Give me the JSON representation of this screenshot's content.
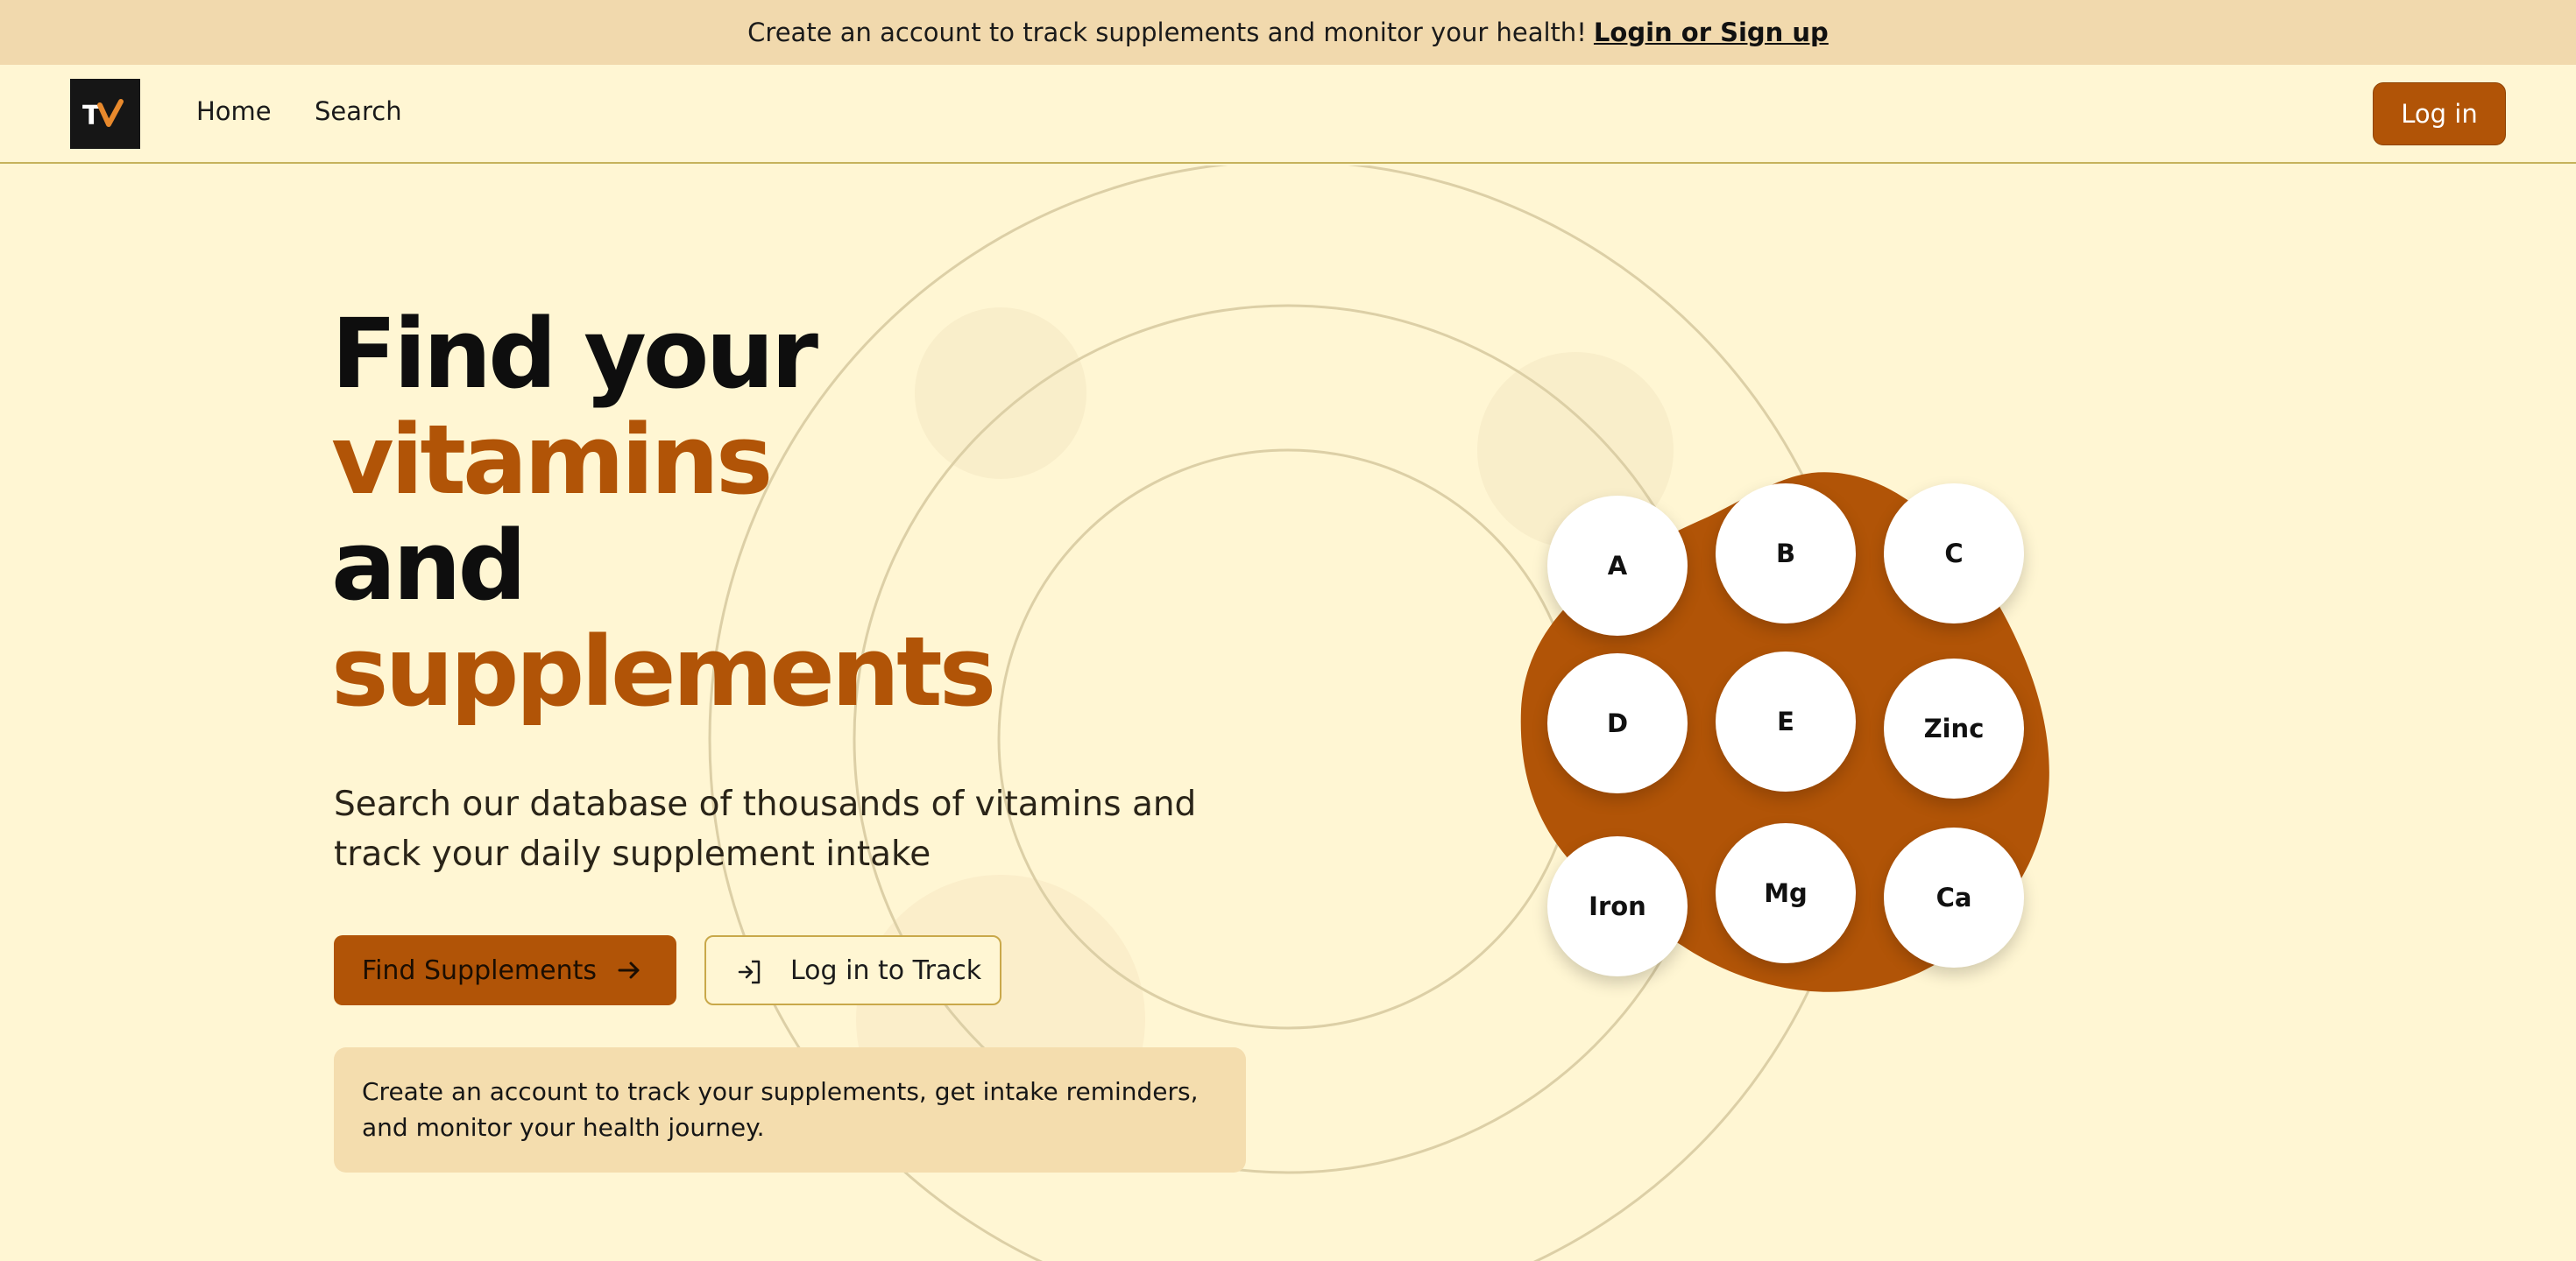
{
  "banner": {
    "message": "Create an account to track supplements and monitor your health!",
    "link_label": "Login or Sign up"
  },
  "nav": {
    "logo_text": "TV",
    "home_label": "Home",
    "search_label": "Search",
    "login_label": "Log in"
  },
  "hero": {
    "title_line1": "Find your",
    "title_line2": "vitamins",
    "title_line3": "and",
    "title_line4": "supplements",
    "subtitle": "Search our database of thousands of vitamins and track your daily supplement intake",
    "primary_button": "Find Supplements",
    "secondary_button": "Log in to Track",
    "info_text": "Create an account to track your supplements, get intake reminders, and monitor your health journey."
  },
  "vitamins": [
    "A",
    "B",
    "C",
    "D",
    "E",
    "Zinc",
    "Iron",
    "Mg",
    "Ca"
  ],
  "colors": {
    "background": "#fff6d3",
    "banner": "#f1d9ad",
    "accent": "#b15407",
    "info_box": "#f4ddae",
    "outline": "#c9a84a"
  },
  "icons": {
    "arrow": "arrow-right-icon",
    "login": "login-icon",
    "logo": "tv-logo-icon"
  }
}
